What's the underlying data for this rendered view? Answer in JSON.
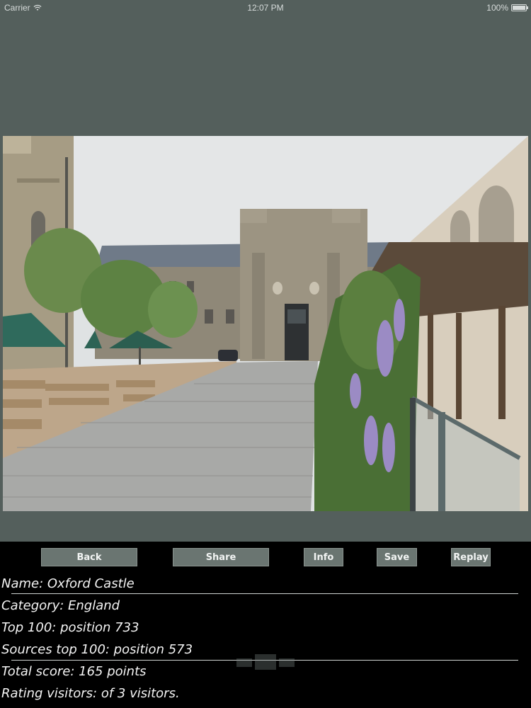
{
  "status_bar": {
    "carrier": "Carrier",
    "time": "12:07 PM",
    "battery_percent": "100%",
    "battery_level": 1.0
  },
  "photo": {
    "subject": "castle-courtyard-photo"
  },
  "toolbar": {
    "back_label": "Back",
    "share_label": "Share",
    "info_label": "Info",
    "save_label": "Save",
    "replay_label": "Replay"
  },
  "details": {
    "name": "Name: Oxford Castle",
    "category": "Category: England",
    "top100": "Top 100: position 733",
    "sources_top100": "Sources top 100: position 573",
    "total_score": "Total score: 165 points",
    "rating_visitors": "Rating visitors: of 3 visitors."
  },
  "colors": {
    "background": "#545f5c",
    "button": "#6a7571",
    "panel": "#000000",
    "text": "#f4f4f4"
  }
}
